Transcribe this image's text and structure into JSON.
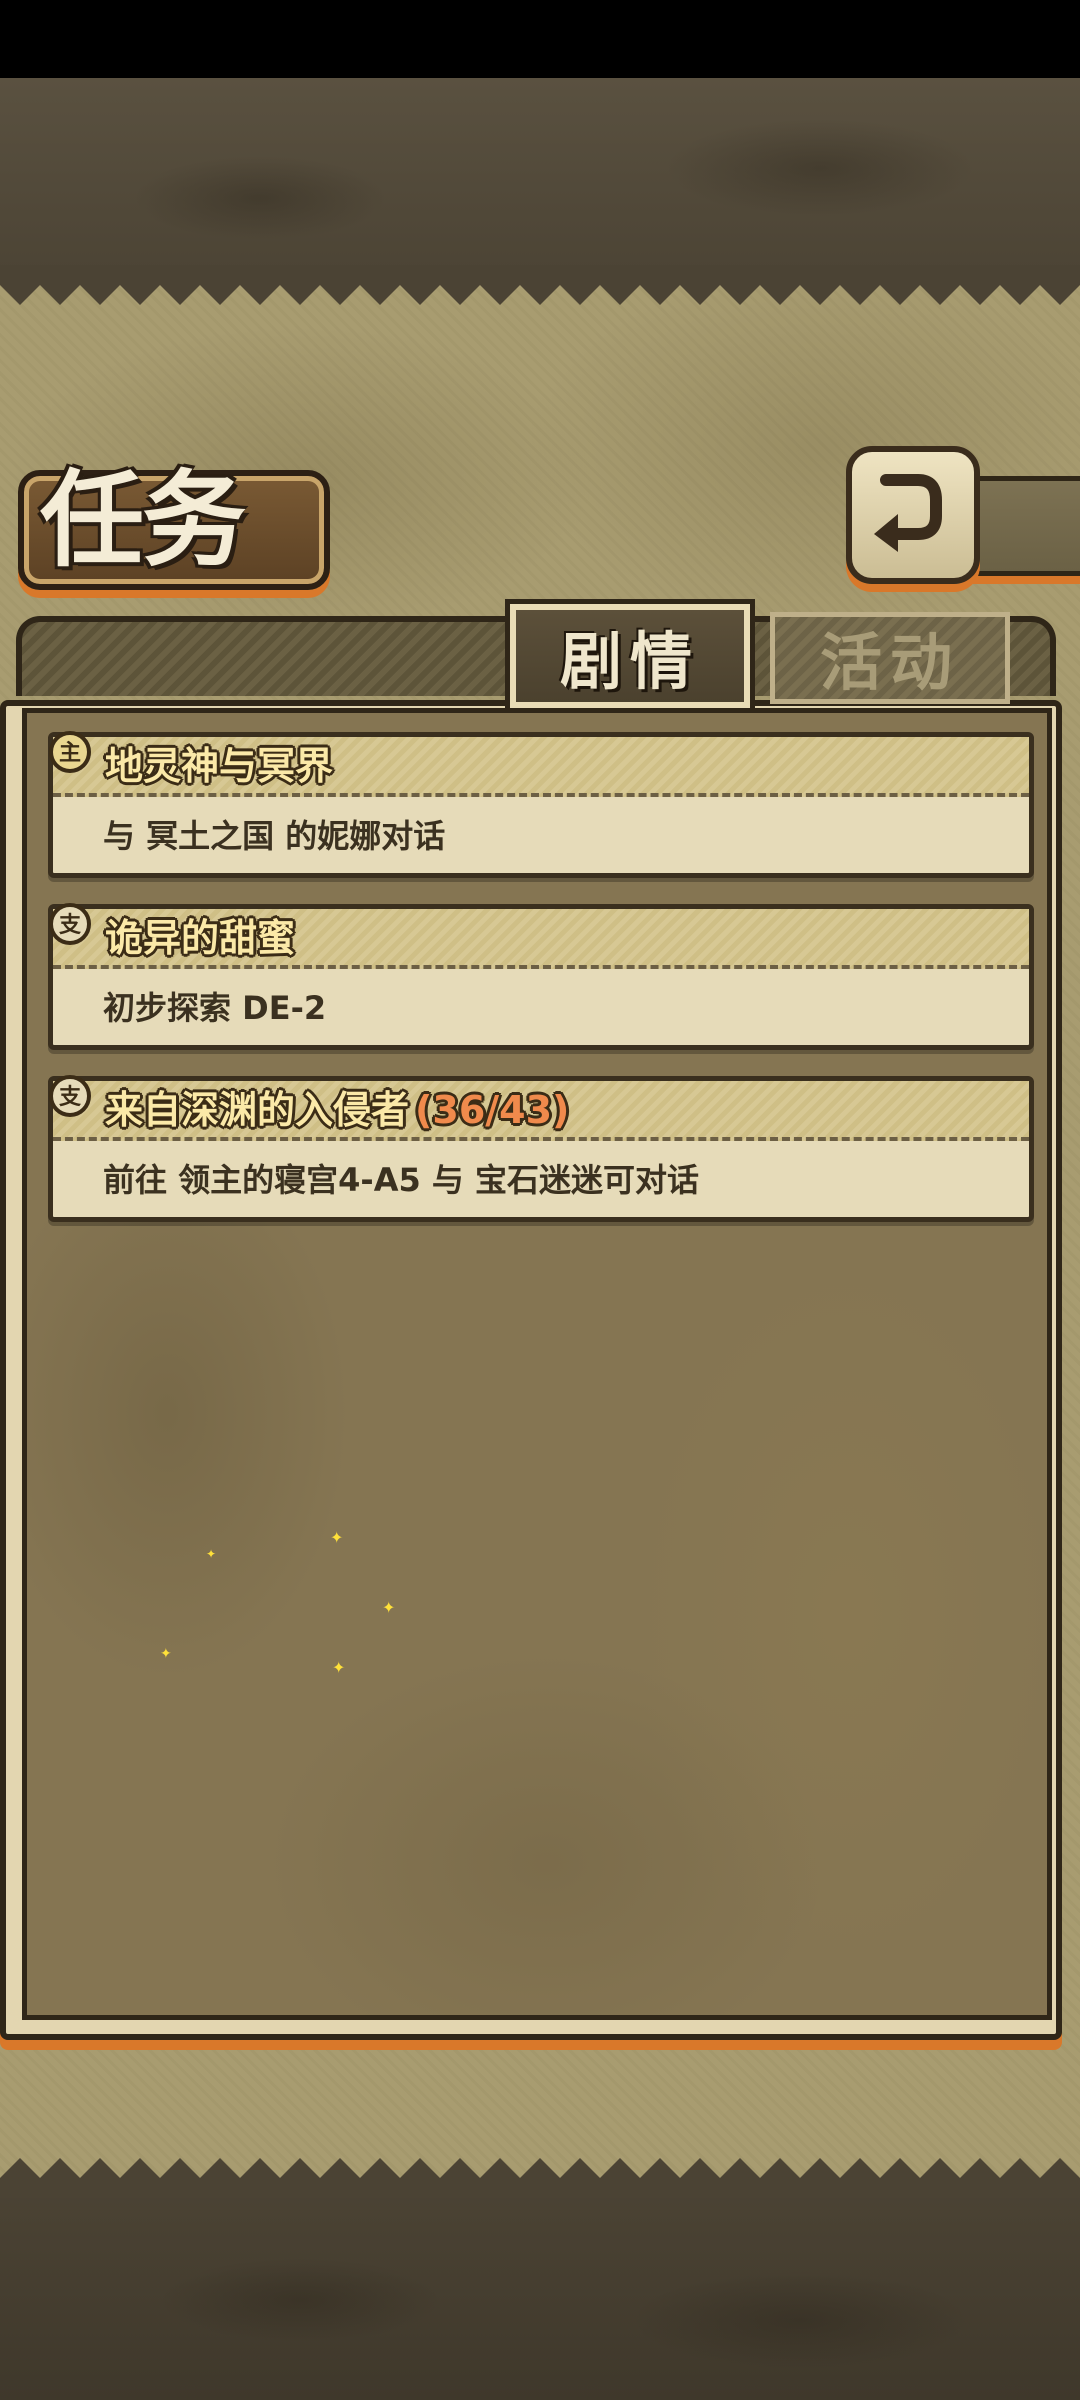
{
  "header": {
    "title": "任务",
    "back_icon": "back-arrow-icon"
  },
  "tabs": [
    {
      "label": "剧情",
      "active": true
    },
    {
      "label": "活动",
      "active": false
    }
  ],
  "quests": [
    {
      "icon": "main-quest-icon",
      "icon_glyph": "主",
      "title": "地灵神与冥界",
      "progress": "",
      "description": "与 冥土之国 的妮娜对话"
    },
    {
      "icon": "side-quest-icon",
      "icon_glyph": "支",
      "title": "诡异的甜蜜",
      "progress": "",
      "description": "初步探索 DE-2"
    },
    {
      "icon": "side-quest-icon",
      "icon_glyph": "支",
      "title": "来自深渊的入侵者",
      "progress": "(36/43)",
      "description": "前往 领主的寝宫4-A5 与 宝石迷迷可对话"
    }
  ],
  "colors": {
    "accent_orange": "#d9782a",
    "title_yellow": "#fbe9a8",
    "progress_orange": "#f08a4c"
  }
}
